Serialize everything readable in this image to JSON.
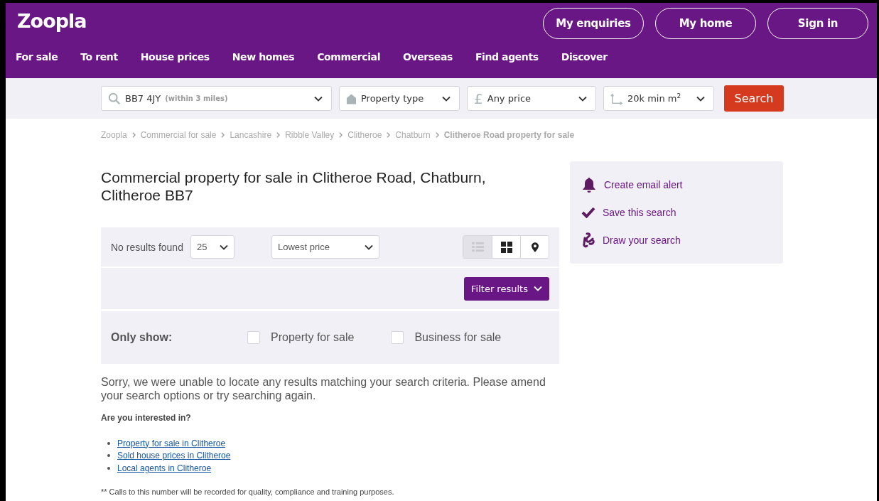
{
  "header": {
    "logo": "Zoopla",
    "account_buttons": [
      "My enquiries",
      "My home",
      "Sign in"
    ],
    "nav": [
      "For sale",
      "To rent",
      "House prices",
      "New homes",
      "Commercial",
      "Overseas",
      "Find agents",
      "Discover"
    ]
  },
  "search_bar": {
    "location": {
      "value": "BB7 4JY",
      "hint": "(within 3 miles)"
    },
    "property_type": "Property type",
    "price": {
      "currency": "£",
      "label": "Any price"
    },
    "size": "20k min m$^{2}$",
    "button": "Search"
  },
  "breadcrumb": [
    {
      "label": "Zoopla",
      "current": false
    },
    {
      "label": "Commercial for sale",
      "current": false
    },
    {
      "label": "Lancashire",
      "current": false
    },
    {
      "label": "Ribble Valley",
      "current": false
    },
    {
      "label": "Clitheroe",
      "current": false
    },
    {
      "label": "Chatburn",
      "current": false
    },
    {
      "label": "Clitheroe Road property for sale",
      "current": true
    }
  ],
  "title": "Commercial property for sale in Clitheroe Road, Chatburn, Clitheroe BB7",
  "results": {
    "count_label": "No results found",
    "per_page": "25",
    "sort": "Lowest price",
    "views": [
      {
        "kind": "list",
        "selected": true
      },
      {
        "kind": "grid",
        "selected": false
      },
      {
        "kind": "map",
        "selected": false
      }
    ],
    "filter_button": "Filter results",
    "only_show": {
      "label": "Only show:",
      "options": [
        {
          "label": "Property for sale",
          "checked": false
        },
        {
          "label": "Business for sale",
          "checked": false
        }
      ]
    }
  },
  "message": "Sorry, we were unable to locate any results matching your search criteria. Please amend your search options or try searching again.",
  "suggestions": {
    "heading": "Are you interested in?",
    "links": [
      "Property for sale in Clitheroe",
      "Sold house prices in Clitheroe",
      "Local agents in Clitheroe"
    ]
  },
  "footnote": "** Calls to this number will be recorded for quality, compliance and training purposes.",
  "sidebar": [
    {
      "kind": "alert",
      "label": "Create email alert"
    },
    {
      "kind": "save",
      "label": "Save this search"
    },
    {
      "kind": "draw",
      "label": "Draw your search"
    }
  ]
}
